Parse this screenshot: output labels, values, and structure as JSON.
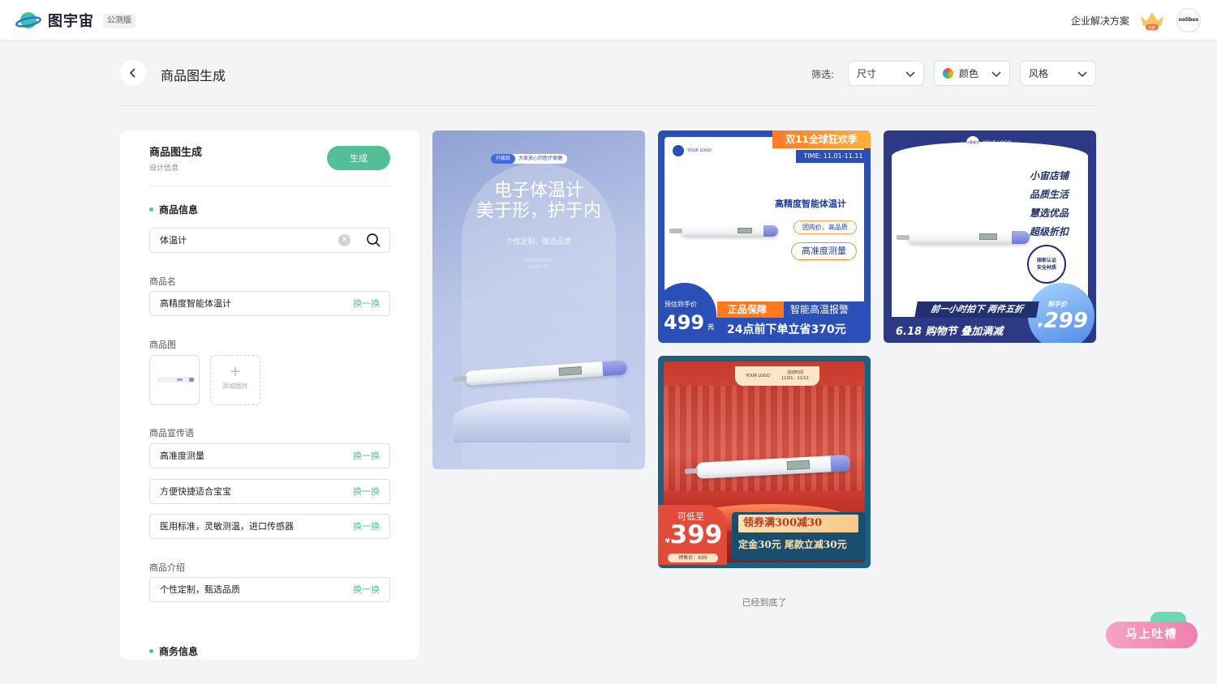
{
  "app": {
    "name": "图宇宙",
    "badge": "公测版",
    "enterprise_link": "企业解决方案",
    "vip": "VIP",
    "avatar_text": "nolibox"
  },
  "page": {
    "title": "商品图生成"
  },
  "filters": {
    "label": "筛选:",
    "size": "尺寸",
    "color": "颜色",
    "style": "风格"
  },
  "panel": {
    "title": "商品图生成",
    "subtitle": "设计信息",
    "generate_label": "生成",
    "product_info_heading": "商品信息",
    "search_value": "体温计",
    "product_name_label": "商品名",
    "product_name_value": "高精度智能体温计",
    "swap_label": "换一换",
    "product_image_label": "商品图",
    "add_image_label": "添加图片",
    "slogan_label": "商品宣传语",
    "slogans": [
      "高准度测量",
      "方便快捷适合宝宝",
      "医用标准，灵敏测温，进口传感器"
    ],
    "intro_label": "商品介绍",
    "intro_value": "个性定制，甄选品质",
    "business_heading": "商务信息"
  },
  "cards": {
    "c1": {
      "tag_pill": "升级款",
      "tag_text": "大家放心的医疗保健",
      "h1_line1": "电子体温计",
      "h1_line2": "美于形，护于内",
      "sub": "个性定制，甄选品质",
      "en1": "EXCELLENT",
      "en2": "QUALITY"
    },
    "c2": {
      "banner": "双11全球狂欢季",
      "time": "TIME: 11.01-11.11",
      "logo": "YOUR LOGO",
      "product": "高精度智能体温计",
      "pill1": "团购价，高品质",
      "pill2": "高准度测量",
      "est_label": "预估到手价",
      "price": "499",
      "unit": "元",
      "strip1": "正品保障",
      "strip1b": "智能高温报警",
      "strip2": "24点前下单立省370元"
    },
    "c3": {
      "logo": "YOUR LOGO",
      "logo_circle": "计算美学",
      "lines": [
        "小宙店铺",
        "品质生活",
        "慧选优品",
        "超级折扣"
      ],
      "seal_line1": "国家认证",
      "seal_line2": "安全材质",
      "ribbon": "前一小时拍下 两件五折",
      "bottom": "6.18 购物节 叠加满减",
      "price_label": "到手价",
      "currency": "¥",
      "price": "299"
    },
    "c4": {
      "logo": "YOUR LOGO",
      "event": "活动时间",
      "dates": "11/01 - 11/11",
      "low_label": "可低至",
      "currency": "¥",
      "price": "399",
      "presale": "预售价：699",
      "coupon1": "领券满300减30",
      "coupon2": "定金30元 尾款立减30元"
    }
  },
  "bottom_note": "已经到底了",
  "feedback": {
    "label": "马上吐槽"
  },
  "colors": {
    "accent": "#52bf97",
    "blue": "#2a4fb6",
    "navy": "#2c3a86"
  }
}
